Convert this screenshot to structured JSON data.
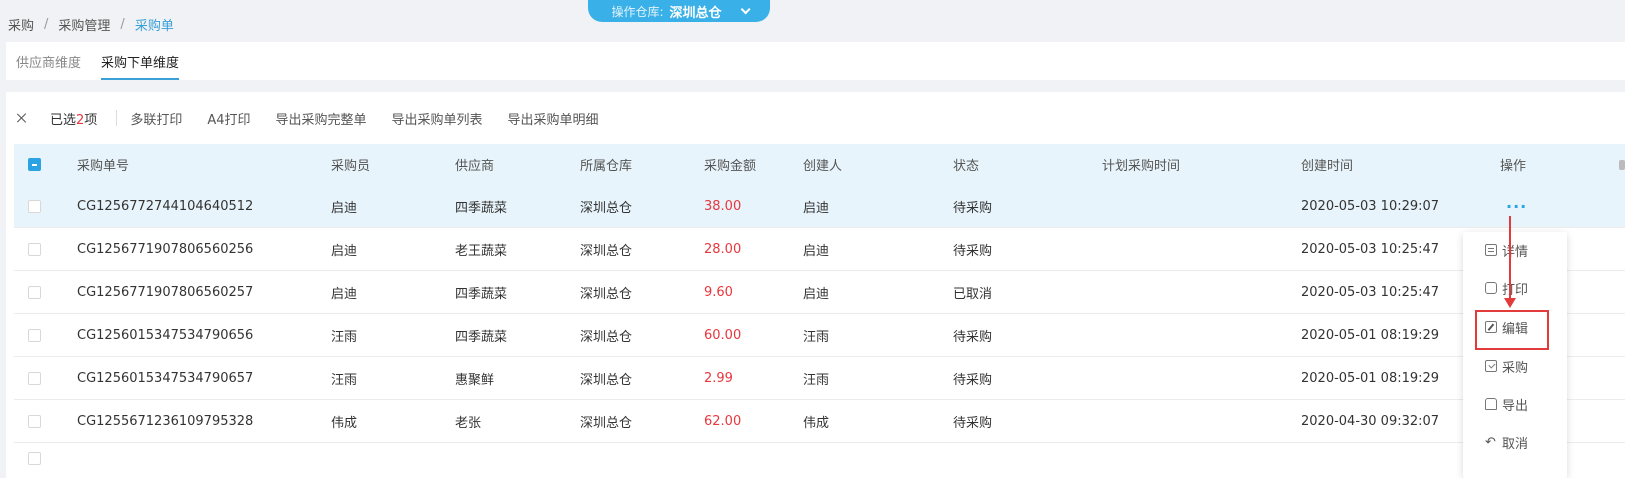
{
  "breadcrumb": [
    "采购",
    "采购管理",
    "采购单"
  ],
  "warehouse": {
    "label": "操作仓库:",
    "value": "深圳总仓"
  },
  "tabs": [
    {
      "label": "供应商维度",
      "active": false
    },
    {
      "label": "采购下单维度",
      "active": true
    }
  ],
  "toolbar": {
    "selected_prefix": "已选",
    "selected_count": "2",
    "selected_suffix": "项",
    "buttons": [
      "多联打印",
      "A4打印",
      "导出采购完整单",
      "导出采购单列表",
      "导出采购单明细"
    ]
  },
  "table": {
    "headers": [
      "采购单号",
      "采购员",
      "供应商",
      "所属仓库",
      "采购金额",
      "创建人",
      "状态",
      "计划采购时间",
      "创建时间",
      "操作"
    ],
    "rows": [
      {
        "id": "CG1256772744104640512",
        "buyer": "启迪",
        "supplier": "四季蔬菜",
        "warehouse": "深圳总仓",
        "amount": "38.00",
        "creator": "启迪",
        "status": "待采购",
        "plan_time": "",
        "created": "2020-05-03 10:29:07"
      },
      {
        "id": "CG1256771907806560256",
        "buyer": "启迪",
        "supplier": "老王蔬菜",
        "warehouse": "深圳总仓",
        "amount": "28.00",
        "creator": "启迪",
        "status": "待采购",
        "plan_time": "",
        "created": "2020-05-03 10:25:47"
      },
      {
        "id": "CG1256771907806560257",
        "buyer": "启迪",
        "supplier": "四季蔬菜",
        "warehouse": "深圳总仓",
        "amount": "9.60",
        "creator": "启迪",
        "status": "已取消",
        "plan_time": "",
        "created": "2020-05-03 10:25:47"
      },
      {
        "id": "CG1256015347534790656",
        "buyer": "汪雨",
        "supplier": "四季蔬菜",
        "warehouse": "深圳总仓",
        "amount": "60.00",
        "creator": "汪雨",
        "status": "待采购",
        "plan_time": "",
        "created": "2020-05-01 08:19:29"
      },
      {
        "id": "CG1256015347534790657",
        "buyer": "汪雨",
        "supplier": "惠聚鲜",
        "warehouse": "深圳总仓",
        "amount": "2.99",
        "creator": "汪雨",
        "status": "待采购",
        "plan_time": "",
        "created": "2020-05-01 08:19:29"
      },
      {
        "id": "CG1255671236109795328",
        "buyer": "伟成",
        "supplier": "老张",
        "warehouse": "深圳总仓",
        "amount": "62.00",
        "creator": "伟成",
        "status": "待采购",
        "plan_time": "",
        "created": "2020-04-30 09:32:07"
      }
    ],
    "more_label": "···"
  },
  "action_menu": [
    "详情",
    "打印",
    "编辑",
    "采购",
    "导出",
    "取消"
  ],
  "colors": {
    "accent": "#2ba3e3",
    "money": "#e8373d",
    "annotation": "#e23b3b"
  }
}
